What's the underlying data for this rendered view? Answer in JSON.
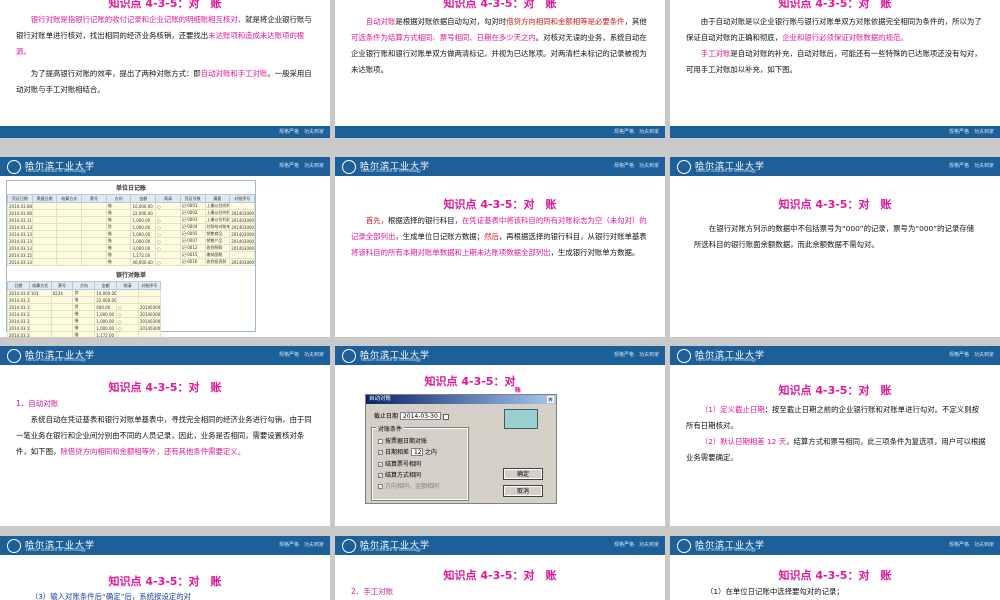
{
  "header": {
    "logo_text": "哈尔滨工业大学",
    "logo_sub": "Harbin Institute of Technology",
    "slogan": "规格严格　功夫到家"
  },
  "slides": {
    "s1": {
      "title": "知识点 4-3-5：对　账",
      "p1_a": "银行对账是指银行记账的收付记录和企业记账的明细账相互核对，",
      "p1_b": "就是将企业银行账与银行对账单进行核对，找出相同的经济业务核销，还要找出",
      "p1_c": "未达账项和造成未达账项的根源。",
      "p2_a": "为了提高银行对账的效率，提出了两种对账方式：即",
      "p2_b": "自动对账和手工对账",
      "p2_c": "。一般采用自动对账与手工对账相结合。"
    },
    "s2": {
      "title": "知识点 4-3-5：对　账",
      "a": "自动对账",
      "b": "是根据对账依据自动勾对，勾对时",
      "c": "借贷方向相同和金额相等是必要条件",
      "d": "，其他",
      "e": "可选条件为结算方式相同、票号相同、日期在多少天之内",
      "f": "。对核对无误的业务，系统自动在企业银行账和银行对账单双方做两清标记，并视为已达账项。对两清栏未标记的记录被视为未达账项。"
    },
    "s3": {
      "title": "知识点 4-3-5：对　账",
      "p1_a": "由于自动对账是以企业银行账与银行对账单双方对账依据完全相同为条件的，所以为了保证自动对账的正确和彻底，",
      "p1_b": "企业和银行必须保证对账数据的规范。",
      "p2_a": "手工对账",
      "p2_b": "是自动对账的补充，自动对账后，可能还有一些特殊的已达账项还没有勾对，可用手工对账加以补充，如下图。"
    },
    "s4": {
      "ledger_title": "单位日记账",
      "ledger_headers": [
        "凭证日期",
        "票据日期",
        "结算方式",
        "票号",
        "方向",
        "金额",
        "两清",
        "凭证号数",
        "摘要",
        "对账序号"
      ],
      "ledger_rows": [
        [
          "2014.03.08",
          "",
          "",
          "",
          "借",
          "10,000.00",
          "○",
          "记-0001",
          "上缴以往的利润",
          ""
        ],
        [
          "2014.03.08",
          "",
          "",
          "",
          "借",
          "22,000.00",
          "",
          "记-0002",
          "上缴以往的利润",
          "20140300001"
        ],
        [
          "2014.03.11",
          "",
          "",
          "",
          "借",
          "1,000.00",
          "○",
          "记-0003",
          "上缴以往利润及借款",
          "20140300002"
        ],
        [
          "2014.03.13",
          "",
          "",
          "",
          "贷",
          "1,000.00",
          "○",
          "记-0004",
          "付款给对账单",
          "20140300003"
        ],
        [
          "2014.03.13",
          "",
          "",
          "",
          "借",
          "1,000.00",
          "○",
          "记-0005",
          "销售商品",
          "20140300004"
        ],
        [
          "2014.03.13",
          "",
          "",
          "",
          "借",
          "1,000.00",
          "○",
          "记-0007",
          "销售产品",
          "20140300005"
        ],
        [
          "2014.03.13",
          "",
          "",
          "",
          "借",
          "3,000.00",
          "○",
          "记-0012",
          "收到预款",
          "20140300006"
        ],
        [
          "2014.03.15",
          "",
          "",
          "",
          "借",
          "1,172.00",
          "",
          "记-0015",
          "缴纳国税",
          ""
        ],
        [
          "2014.03.13",
          "",
          "",
          "",
          "借",
          "40,000.00",
          "○",
          "记-0016",
          "收到投资款",
          "20140300004"
        ]
      ],
      "bank_title": "银行对账单",
      "bank_headers": [
        "日期",
        "结算方式",
        "票号",
        "方向",
        "金额",
        "两清",
        "对账序号"
      ],
      "bank_rows": [
        [
          "2014.03.01",
          "101",
          "0234",
          "贷",
          "10,000.00",
          "",
          ""
        ],
        [
          "2014.03.10",
          "",
          "",
          "借",
          "22,000.00",
          "",
          ""
        ],
        [
          "2014.03.11",
          "",
          "",
          "贷",
          "400.00",
          "○",
          "20140300002"
        ],
        [
          "2014.03.13",
          "",
          "",
          "借",
          "1,000.00",
          "○",
          "20140300003"
        ],
        [
          "2014.03.13",
          "",
          "",
          "借",
          "1,000.00",
          "○",
          "20140300004"
        ],
        [
          "2014.03.13",
          "",
          "",
          "借",
          "1,000.00",
          "○",
          "20140300005"
        ],
        [
          "2014.03.13",
          "",
          "",
          "借",
          "1,172.00",
          "",
          ""
        ],
        [
          "2014.03.13",
          "101",
          "1231",
          "借",
          "3,000.00",
          "○",
          "20140300006"
        ],
        [
          "2014.03.13",
          "",
          "",
          "借",
          "10,000.00",
          "○",
          "20140300001"
        ]
      ]
    },
    "s5": {
      "title": "知识点 4-3-5：对　账",
      "a": "首先，",
      "b": "根据选择的银行科目，",
      "c": "在凭证基表中将该科目的所有对账标志为空（未勾对）的记录全部列出",
      "d": "，生成单位日记账方数据；",
      "e": "然后",
      "f": "，再根据选择的银行科目，从银行对账单基表",
      "g": "将该科目的所有本期对账单数据和上期未达账项数据全部列出",
      "h": "，生成银行对账单方数据。"
    },
    "s6": {
      "title": "知识点 4-3-5：对　账",
      "p1": "在银行对账方列示的数据中不包括票号为“000”的记录，票号为“000”的记录存储所选科目的银行账面余额数据，而此余额数据不需勾对。"
    },
    "s7": {
      "title": "知识点 4-3-5：对　账",
      "section": "1．自动对账",
      "p1_a": "系统自动在凭证基表和银行对账单基表中，寻找完全相同的经济业务进行勾销，由于同一笔业务在银行和企业间分别由不同的人员记录，因此，业务是否相同，需要设置核对条件，如下图，",
      "p1_b": "除借贷方向相同和金额相等外，还有其他条件需要定义。"
    },
    "s8": {
      "title": "知识点 4-3-5：对",
      "title_tail": "账",
      "dialog_title": "自动对账",
      "close_label": "×",
      "date_label": "截止日期",
      "date_value": "2014-03-30",
      "group_label": "对账条件",
      "cond1": "按票据日期对账",
      "cond2_a": "日期相差",
      "cond2_days": "12",
      "cond2_b": "之内",
      "cond3": "结算票号相同",
      "cond4": "结算方式相同",
      "cond5": "方向相同，金额相同",
      "check_mark": "✓",
      "ok_label": "确定",
      "cancel_label": "取消"
    },
    "s9": {
      "title": "知识点 4-3-5：对　账",
      "p1_a": "（1）",
      "p1_b": "定义截止日期",
      "p1_c": "：按至截止日期之前的企业银行账和对账单进行勾对。不定义则按所有日期核对。",
      "p2_a": "（2）",
      "p2_b": "默认日期相差 12 天",
      "p2_c": "，结算方式和票号相同，此三项条件为复选项，用户可以根据业务需要确定。"
    },
    "s10": {
      "title": "知识点 4-3-5：对　账",
      "p1": "（3）输入对账条件后“确定”后，系统按设定的对"
    },
    "s11": {
      "title": "知识点 4-3-5：对　账",
      "section": "2．手工对账"
    },
    "s12": {
      "title": "知识点 4-3-5：对　账",
      "p1": "（1）在单位日记账中选择要勾对的记录；"
    }
  }
}
